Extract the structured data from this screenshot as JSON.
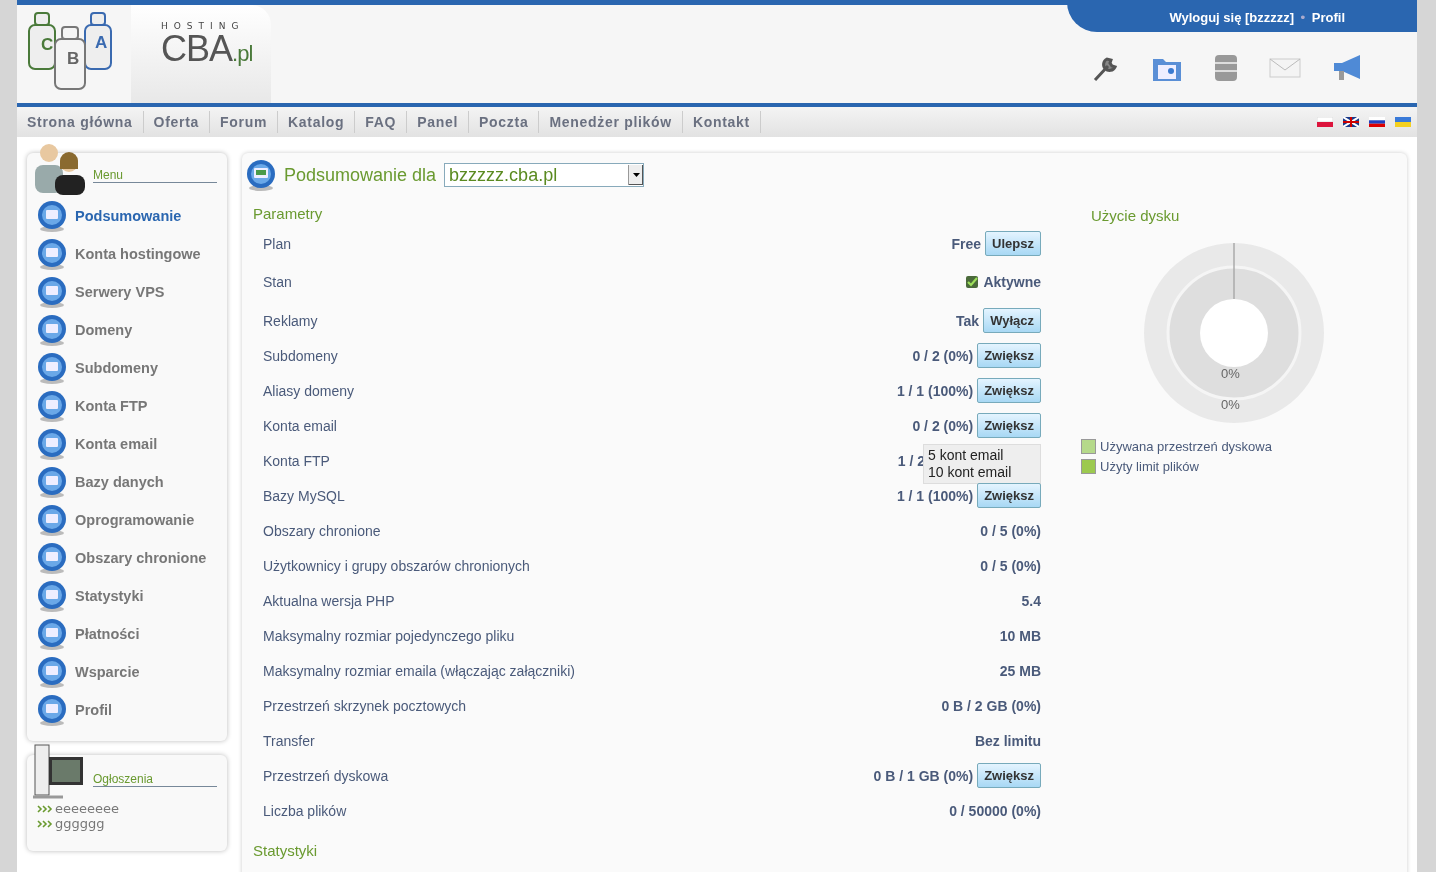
{
  "header": {
    "logo_letters": [
      "C",
      "B",
      "A"
    ],
    "logo_small": "HOSTING",
    "logo_main": "CBA",
    "logo_suffix": ".pl",
    "logout": "Wyloguj się [bzzzzz]",
    "separator": "•",
    "profile": "Profil"
  },
  "nav": [
    "Strona główna",
    "Oferta",
    "Forum",
    "Katalog",
    "FAQ",
    "Panel",
    "Poczta",
    "Menedżer plików",
    "Kontakt"
  ],
  "sidebar": {
    "title": "Menu",
    "items": [
      {
        "label": "Podsumowanie",
        "selected": true
      },
      {
        "label": "Konta hostingowe",
        "selected": false
      },
      {
        "label": "Serwery VPS",
        "selected": false
      },
      {
        "label": "Domeny",
        "selected": false
      },
      {
        "label": "Subdomeny",
        "selected": false
      },
      {
        "label": "Konta FTP",
        "selected": false
      },
      {
        "label": "Konta email",
        "selected": false
      },
      {
        "label": "Bazy danych",
        "selected": false
      },
      {
        "label": "Oprogramowanie",
        "selected": false
      },
      {
        "label": "Obszary chronione",
        "selected": false
      },
      {
        "label": "Statystyki",
        "selected": false
      },
      {
        "label": "Płatności",
        "selected": false
      },
      {
        "label": "Wsparcie",
        "selected": false
      },
      {
        "label": "Profil",
        "selected": false
      }
    ]
  },
  "announcements": {
    "title": "Ogłoszenia",
    "items": [
      "eeeeeeee",
      "gggggg"
    ]
  },
  "main": {
    "title": "Podsumowanie dla",
    "domain": "bzzzzz.cba.pl",
    "section": "Parametry",
    "rows": [
      {
        "kind": "button",
        "label": "Plan",
        "value": "Free",
        "button": "Ulepsz"
      },
      {
        "kind": "status",
        "label": "Stan",
        "value": "Aktywne",
        "checked": true
      },
      {
        "kind": "button",
        "label": "Reklamy",
        "value": "Tak",
        "button": "Wyłącz"
      },
      {
        "kind": "button",
        "label": "Subdomeny",
        "value": "0 / 2 (0%)",
        "button": "Zwiększ"
      },
      {
        "kind": "button",
        "label": "Aliasy domeny",
        "value": "1 / 1 (100%)",
        "button": "Zwiększ"
      },
      {
        "kind": "button",
        "label": "Konta email",
        "value": "0 / 2 (0%)",
        "button": "Zwiększ"
      },
      {
        "kind": "covered",
        "label": "Konta FTP",
        "value": "1 / 2"
      },
      {
        "kind": "button",
        "label": "Bazy MySQL",
        "value": "1 / 1 (100%)",
        "button": "Zwiększ"
      },
      {
        "kind": "plain",
        "label": "Obszary chronione",
        "value": "0 / 5 (0%)"
      },
      {
        "kind": "plain",
        "label": "Użytkownicy i grupy obszarów chronionych",
        "value": "0 / 5 (0%)"
      },
      {
        "kind": "plain",
        "label": "Aktualna wersja PHP",
        "value": "5.4"
      },
      {
        "kind": "plain",
        "label": "Maksymalny rozmiar pojedynczego pliku",
        "value": "10 MB"
      },
      {
        "kind": "plain",
        "label": "Maksymalny rozmiar emaila (włączając załączniki)",
        "value": "25 MB"
      },
      {
        "kind": "plain",
        "label": "Przestrzeń skrzynek pocztowych",
        "value": "0 B / 2 GB (0%)"
      },
      {
        "kind": "plain",
        "label": "Transfer",
        "value": "Bez limitu"
      },
      {
        "kind": "button",
        "label": "Przestrzeń dyskowa",
        "value": "0 B / 1 GB (0%)",
        "button": "Zwiększ"
      },
      {
        "kind": "plain",
        "label": "Liczba plików",
        "value": "0 / 50000 (0%)"
      }
    ],
    "popup": [
      "5 kont email",
      "10 kont email"
    ],
    "next_section": "Statystyki"
  },
  "disk": {
    "title": "Użycie dysku",
    "inner_label": "0%",
    "outer_label": "0%",
    "legend": [
      {
        "label": "Używana przestrzeń dyskowa",
        "color": "#b5d98a"
      },
      {
        "label": "Użyty limit plików",
        "color": "#9cc94f"
      }
    ]
  }
}
